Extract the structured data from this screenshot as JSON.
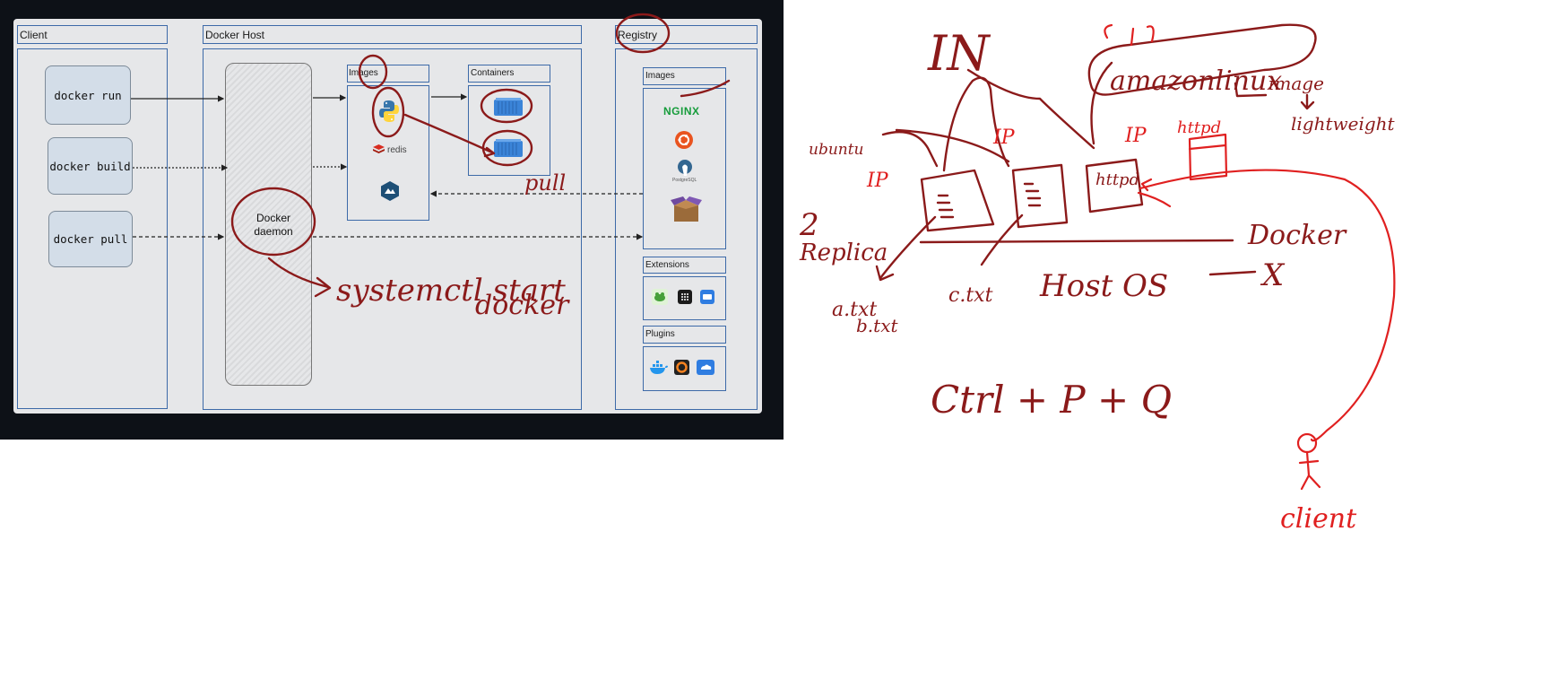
{
  "diagram": {
    "client_title": "Client",
    "host_title": "Docker Host",
    "registry_title": "Registry",
    "commands": [
      "docker run",
      "docker build",
      "docker pull"
    ],
    "daemon_label": "Docker daemon",
    "host_images_title": "Images",
    "containers_title": "Containers",
    "redis_label": "redis",
    "registry_images_title": "Images",
    "nginx_label": "NGINX",
    "postgres_label": "PostgreSQL",
    "extensions_title": "Extensions",
    "plugins_title": "Plugins"
  },
  "annotations": {
    "systemctl": "systemctl start",
    "docker": "docker",
    "pull": "pull",
    "in": "IN",
    "amazonlinux": "amazonlinux",
    "image": "image",
    "lightweight": "lightweight",
    "ubuntu": "ubuntu",
    "ip_left": "IP",
    "ip_mid": "IP",
    "ip_right": "IP",
    "httpd_box": "httpd",
    "httpd_label": "httpd",
    "two": "2",
    "replica": "Replica",
    "code_left_1": "a.txt",
    "code_left_2": "b.txt",
    "code_mid": "c.txt",
    "docker_right": "Docker",
    "hostos": "Host OS",
    "x_mark": "X",
    "ctrl": "Ctrl + P + Q",
    "client": "client"
  },
  "colors": {
    "ink_dark": "#8b1a1a",
    "ink_red": "#e02020",
    "frame_blue": "#3d6aa8"
  }
}
